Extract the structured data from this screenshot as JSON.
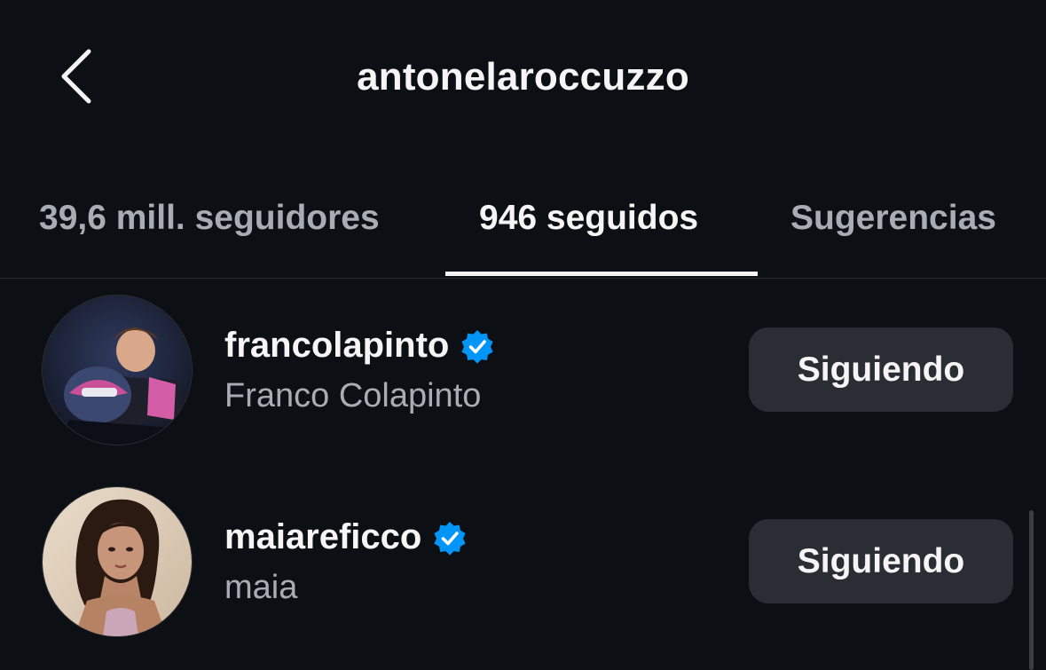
{
  "header": {
    "title": "antonelaroccuzzo",
    "back_icon": "chevron-left-icon"
  },
  "tabs": [
    {
      "label": "39,6 mill. seguidores",
      "active": false
    },
    {
      "label": "946 seguidos",
      "active": true
    },
    {
      "label": "Sugerencias",
      "active": false
    }
  ],
  "users": [
    {
      "username": "francolapinto",
      "full_name": "Franco Colapinto",
      "verified": true,
      "button_label": "Siguiendo"
    },
    {
      "username": "maiareficco",
      "full_name": "maia",
      "verified": true,
      "button_label": "Siguiendo"
    }
  ],
  "colors": {
    "background": "#0c1014",
    "verified_badge": "#0095f6",
    "button_bg": "#2a2d33",
    "secondary_text": "#a8adb3"
  }
}
